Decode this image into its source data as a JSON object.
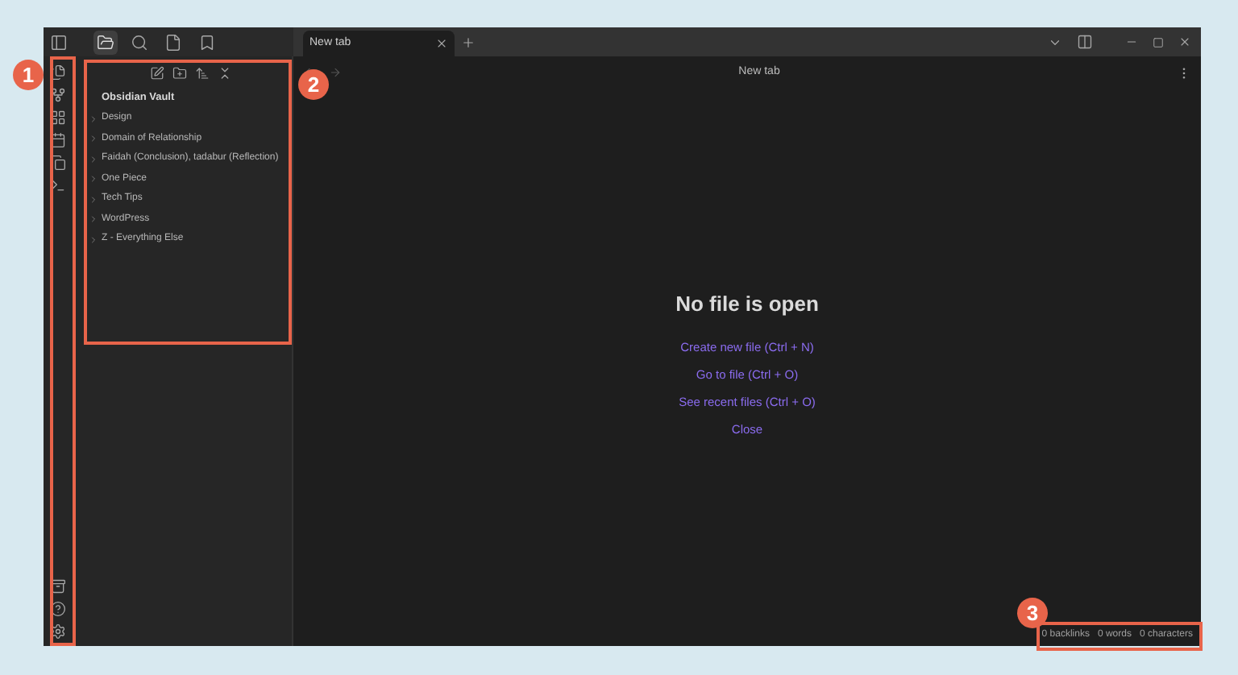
{
  "sidebar_views": [
    {
      "kind": "files",
      "selected": true
    },
    {
      "kind": "search",
      "selected": false
    },
    {
      "kind": "file",
      "selected": false
    },
    {
      "kind": "bookmarks",
      "selected": false
    }
  ],
  "tabs": [
    {
      "label": "New tab",
      "selected": true
    }
  ],
  "file_tree": {
    "vault": "Obsidian Vault",
    "items": [
      {
        "label": "Design",
        "expanded": false
      },
      {
        "label": "Domain of Relationship",
        "expanded": false
      },
      {
        "label": "Faidah (Conclusion), tadabur (Reflection)",
        "expanded": false
      },
      {
        "label": "One Piece",
        "expanded": false
      },
      {
        "label": "Tech Tips",
        "expanded": false
      },
      {
        "label": "WordPress",
        "expanded": false
      },
      {
        "label": "Z - Everything Else",
        "expanded": false
      }
    ]
  },
  "editor": {
    "title": "New tab",
    "empty_title": "No file is open",
    "actions": [
      "Create new file (Ctrl + N)",
      "Go to file (Ctrl + O)",
      "See recent files (Ctrl + O)",
      "Close"
    ]
  },
  "status_bar": [
    "0 backlinks",
    "0 words",
    "0 characters"
  ],
  "annotations": [
    {
      "label": "1"
    },
    {
      "label": "2"
    },
    {
      "label": "3"
    }
  ]
}
